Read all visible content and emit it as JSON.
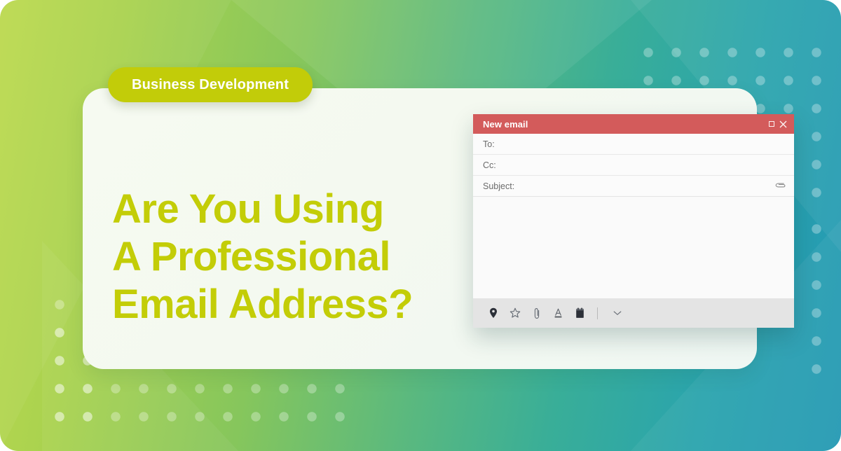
{
  "badge": {
    "label": "Business Development"
  },
  "headline": {
    "line1": "Are You Using",
    "line2": "A Professional",
    "line3": "Email Address?"
  },
  "email_window": {
    "title": "New email",
    "window_controls": {
      "minimize": "minimize-icon",
      "maximize": "maximize-icon",
      "close": "close-icon"
    },
    "fields": [
      {
        "label": "To:",
        "value": "",
        "placeholder": ""
      },
      {
        "label": "Cc:",
        "value": "",
        "placeholder": ""
      },
      {
        "label": "Subject:",
        "value": "",
        "placeholder": ""
      }
    ],
    "attach_icon": "paperclip-icon",
    "body_value": "",
    "toolbar_icons": [
      "location-pin-icon",
      "star-icon",
      "paperclip-icon",
      "text-color-icon",
      "notebook-icon"
    ],
    "toolbar_more": "chevron-down-icon"
  },
  "colors": {
    "accent_green": "#c3cd07",
    "badge_green": "#c2cc09",
    "header_red": "#d35b5b",
    "card_bg": "#f4f9f0",
    "bg_start": "#bcd94f",
    "bg_end": "#2499b4",
    "toolbar_bg": "#e4e4e4"
  }
}
